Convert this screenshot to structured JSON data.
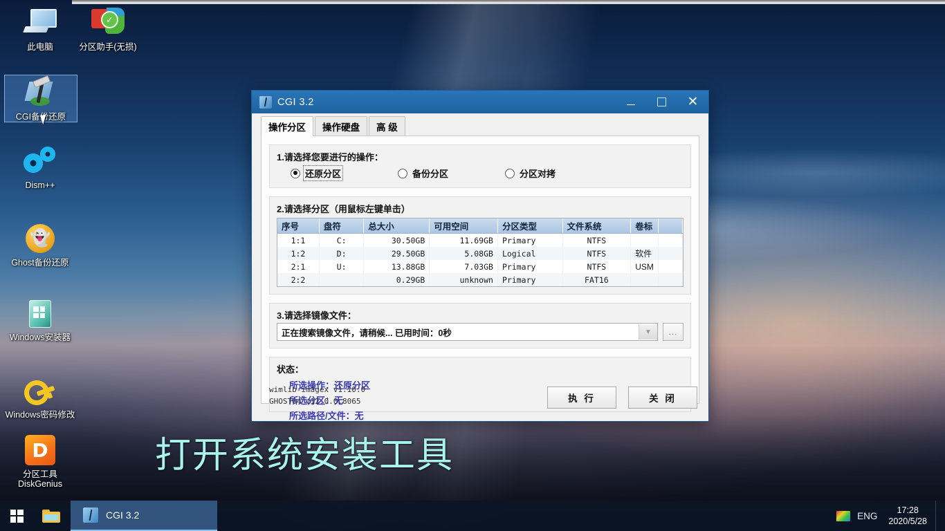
{
  "desktop": {
    "icons": [
      {
        "name": "this-pc",
        "label": "此电脑",
        "icon": "monitor-icon"
      },
      {
        "name": "partition-assistant",
        "label": "分区助手(无损)",
        "icon": "pie-chart-icon"
      },
      {
        "name": "cgi-backup-restore",
        "label": "CGI备份还原",
        "icon": "hammer-disk-icon",
        "selected": true
      },
      {
        "name": "dism-plus-plus",
        "label": "Dism++",
        "icon": "gears-icon"
      },
      {
        "name": "ghost-backup-restore",
        "label": "Ghost备份还原",
        "icon": "ghost-icon"
      },
      {
        "name": "windows-installer",
        "label": "Windows安装器",
        "icon": "windows-box-icon"
      },
      {
        "name": "windows-password-change",
        "label": "Windows密码修改",
        "icon": "key-icon"
      },
      {
        "name": "diskgenius",
        "label": "分区工具\nDiskGenius",
        "icon": "diskgenius-icon"
      }
    ],
    "caption": "打开系统安装工具"
  },
  "window": {
    "title": "CGI 3.2",
    "controls": {
      "minimize": "minimize-button",
      "maximize": "maximize-button",
      "close": "✕"
    },
    "tabs": [
      {
        "label": "操作分区",
        "active": true
      },
      {
        "label": "操作硬盘",
        "active": false
      },
      {
        "label": "高 级",
        "active": false
      }
    ],
    "section1": {
      "title": "1.请选择您要进行的操作：",
      "options": [
        {
          "label": "还原分区",
          "selected": true
        },
        {
          "label": "备份分区",
          "selected": false
        },
        {
          "label": "分区对拷",
          "selected": false
        }
      ]
    },
    "section2": {
      "title": "2.请选择分区（用鼠标左键单击）",
      "columns": [
        "序号",
        "盘符",
        "总大小",
        "可用空间",
        "分区类型",
        "文件系统",
        "卷标",
        ""
      ],
      "rows": [
        {
          "index": "1:1",
          "drive": "C:",
          "size": "30.50GB",
          "free": "11.69GB",
          "type": "Primary",
          "fs": "NTFS",
          "label": ""
        },
        {
          "index": "1:2",
          "drive": "D:",
          "size": "29.50GB",
          "free": "5.08GB",
          "type": "Logical",
          "fs": "NTFS",
          "label": "软件"
        },
        {
          "index": "2:1",
          "drive": "U:",
          "size": "13.88GB",
          "free": "7.03GB",
          "type": "Primary",
          "fs": "NTFS",
          "label": "USM"
        },
        {
          "index": "2:2",
          "drive": "",
          "size": "0.29GB",
          "free": "unknown",
          "type": "Primary",
          "fs": "FAT16",
          "label": ""
        }
      ]
    },
    "section3": {
      "title": "3.请选择镜像文件：",
      "combo_value": "正在搜索镜像文件，请稍候...    已用时间：0秒",
      "browse_label": "..."
    },
    "status": {
      "title": "状态：",
      "lines": [
        "所选操作：还原分区",
        "所选分区：无",
        "所选路径/文件：无"
      ],
      "color": "#3b3bb5"
    },
    "footer": {
      "version_line1": "wimlib-imagex v1.10.0",
      "version_line2": "GHOST64 v12.0.0.8065",
      "exec_label": "执 行",
      "close_label": "关 闭"
    }
  },
  "taskbar": {
    "start": "windows-logo",
    "explorer": "file-explorer-icon",
    "task_label": "CGI 3.2",
    "tray_language": "ENG",
    "clock_time": "17:28",
    "clock_date": "2020/5/28"
  }
}
